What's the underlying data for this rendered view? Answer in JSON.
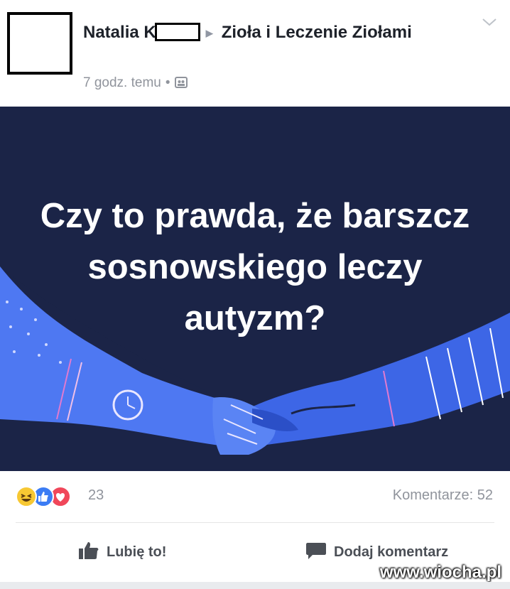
{
  "post": {
    "author_first": "Natalia K",
    "group_name": "Zioła i Leczenie Ziołami",
    "time": "7 godz. temu",
    "separator": "•"
  },
  "image": {
    "headline": "Czy to prawda, że barszcz sosnowskiego leczy autyzm?",
    "background_color": "#1b2447",
    "arm_color": "#4e78f2"
  },
  "stats": {
    "reactions_count": "23",
    "comments_label": "Komentarze: 52"
  },
  "actions": {
    "like_label": "Lubię to!",
    "comment_label": "Dodaj komentarz"
  },
  "watermark": "www.wiocha.pl",
  "icons": [
    "chevron-down-icon",
    "public-icon",
    "haha-reaction-icon",
    "like-reaction-icon",
    "love-reaction-icon",
    "thumbs-up-icon",
    "comment-icon"
  ]
}
